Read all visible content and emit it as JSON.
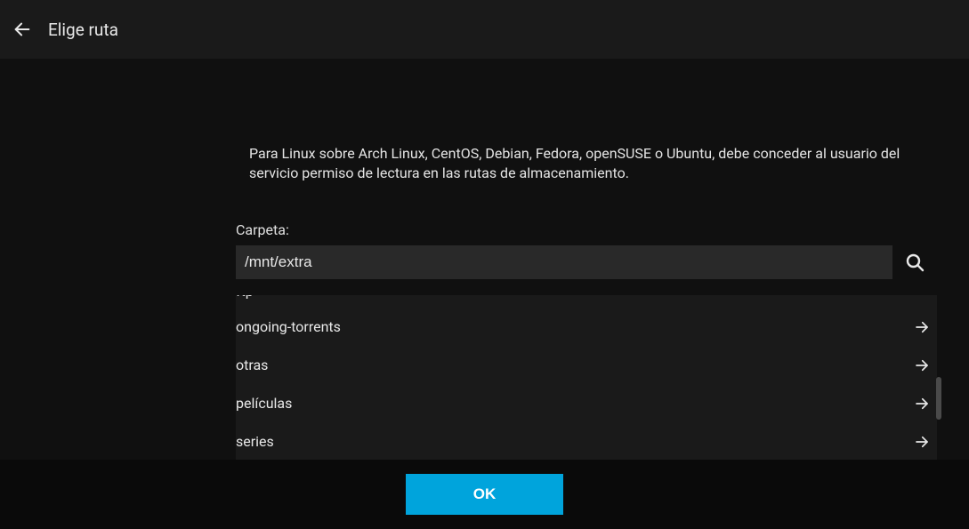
{
  "header": {
    "title": "Elige ruta"
  },
  "info": {
    "text": "Para Linux sobre Arch Linux, CentOS, Debian, Fedora, openSUSE o Ubuntu, debe conceder al usuario del servicio permiso de lectura en las rutas de almacenamiento."
  },
  "field": {
    "label": "Carpeta:",
    "value": "/mnt/extra"
  },
  "folders": {
    "partial": "ftp",
    "items": [
      {
        "name": "ongoing-torrents"
      },
      {
        "name": "otras"
      },
      {
        "name": "películas"
      },
      {
        "name": "series"
      }
    ]
  },
  "footer": {
    "ok_label": "OK"
  }
}
